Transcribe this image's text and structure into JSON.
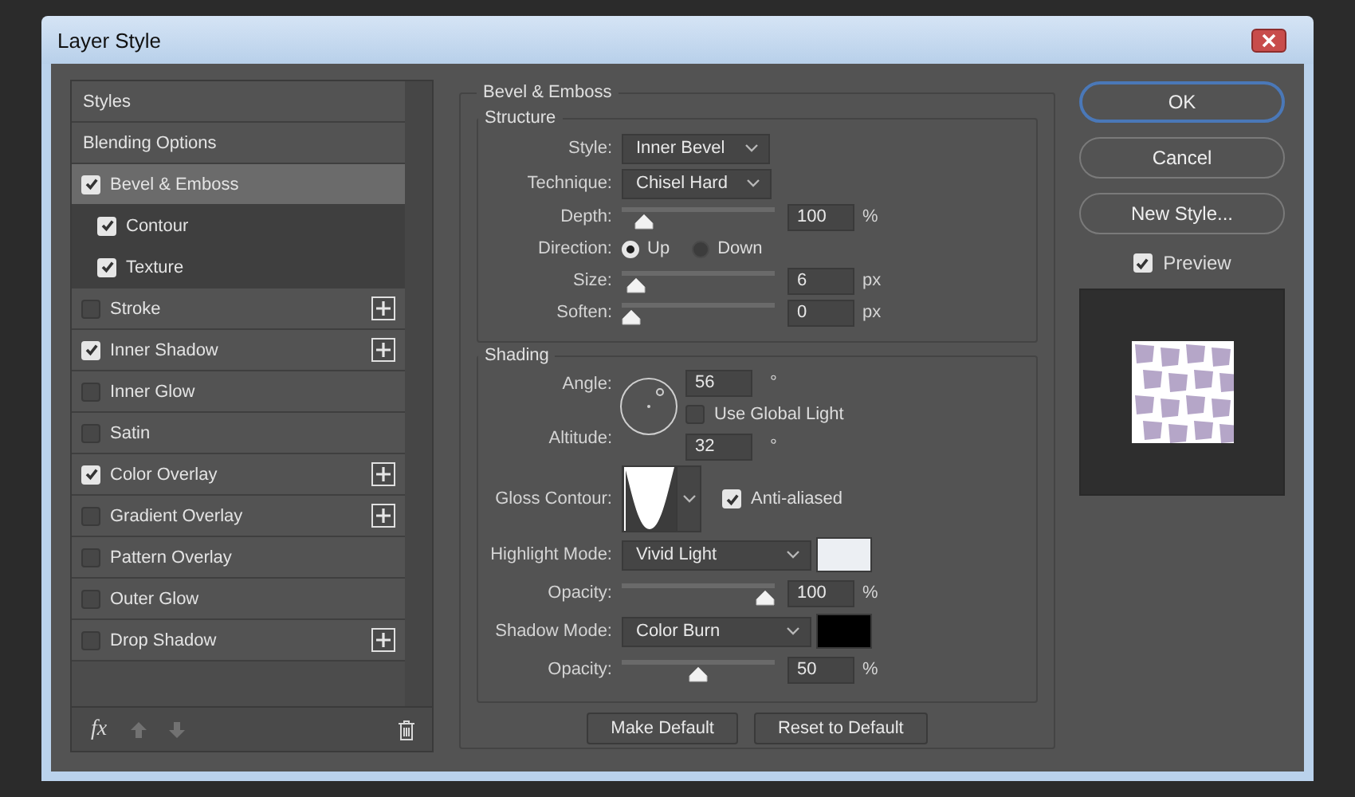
{
  "window": {
    "title": "Layer Style"
  },
  "sidebar": {
    "items": [
      {
        "label": "Styles",
        "kind": "header",
        "selected": false,
        "add": false
      },
      {
        "label": "Blending Options",
        "kind": "header",
        "selected": false,
        "add": false
      },
      {
        "label": "Bevel & Emboss",
        "kind": "effect",
        "checked": true,
        "selected": true,
        "add": false,
        "children": [
          {
            "label": "Contour",
            "kind": "effect",
            "checked": true,
            "selected": false,
            "add": false
          },
          {
            "label": "Texture",
            "kind": "effect",
            "checked": true,
            "selected": false,
            "add": false
          }
        ]
      },
      {
        "label": "Stroke",
        "kind": "effect",
        "checked": false,
        "selected": false,
        "add": true
      },
      {
        "label": "Inner Shadow",
        "kind": "effect",
        "checked": true,
        "selected": false,
        "add": true
      },
      {
        "label": "Inner Glow",
        "kind": "effect",
        "checked": false,
        "selected": false,
        "add": false
      },
      {
        "label": "Satin",
        "kind": "effect",
        "checked": false,
        "selected": false,
        "add": false
      },
      {
        "label": "Color Overlay",
        "kind": "effect",
        "checked": true,
        "selected": false,
        "add": true
      },
      {
        "label": "Gradient Overlay",
        "kind": "effect",
        "checked": false,
        "selected": false,
        "add": true
      },
      {
        "label": "Pattern Overlay",
        "kind": "effect",
        "checked": false,
        "selected": false,
        "add": false
      },
      {
        "label": "Outer Glow",
        "kind": "effect",
        "checked": false,
        "selected": false,
        "add": false
      },
      {
        "label": "Drop Shadow",
        "kind": "effect",
        "checked": false,
        "selected": false,
        "add": true
      }
    ],
    "toolbar": {
      "fx_label": "fx",
      "move_up": {
        "disabled": true
      },
      "move_down": {
        "disabled": true
      }
    }
  },
  "settings": {
    "title": "Bevel & Emboss",
    "structure": {
      "title": "Structure",
      "rows": [
        {
          "kind": "dropdown",
          "label": "Style:",
          "value": "Inner Bevel"
        },
        {
          "kind": "dropdown",
          "label": "Technique:",
          "value": "Chisel Hard"
        },
        {
          "kind": "slider",
          "label": "Depth:",
          "level": 0.1,
          "value": "100",
          "unit": "%"
        },
        {
          "kind": "radio",
          "label": "Direction:",
          "options": [
            {
              "label": "Up",
              "selected": true
            },
            {
              "label": "Down",
              "selected": false
            }
          ]
        },
        {
          "kind": "slider",
          "label": "Size:",
          "level": 0.04,
          "value": "6",
          "unit": "px"
        },
        {
          "kind": "slider",
          "label": "Soften:",
          "level": 0,
          "value": "0",
          "unit": "px"
        }
      ]
    },
    "shading": {
      "title": "Shading",
      "angle": {
        "label": "Angle:",
        "value": "56",
        "unit": "°"
      },
      "global_light": {
        "label": "Use Global Light",
        "checked": false
      },
      "altitude": {
        "label": "Altitude:",
        "value": "32",
        "unit": "°"
      },
      "gloss_contour": {
        "label": "Gloss Contour:"
      },
      "anti_aliased": {
        "label": "Anti-aliased",
        "checked": true
      },
      "rows": [
        {
          "kind": "mode",
          "label": "Highlight Mode:",
          "value": "Vivid Light",
          "color": "#eceff3"
        },
        {
          "kind": "slider",
          "label": "Opacity:",
          "level": 1,
          "value": "100",
          "unit": "%"
        },
        {
          "kind": "mode",
          "label": "Shadow Mode:",
          "value": "Color Burn",
          "color": "#000000"
        },
        {
          "kind": "slider",
          "label": "Opacity:",
          "level": 0.5,
          "value": "50",
          "unit": "%"
        }
      ]
    },
    "buttons": [
      "Make Default",
      "Reset to Default"
    ]
  },
  "actions": {
    "buttons": [
      {
        "label": "OK",
        "kind": "primary"
      },
      {
        "label": "Cancel",
        "kind": "normal"
      },
      {
        "label": "New Style...",
        "kind": "normal"
      }
    ],
    "preview": {
      "label": "Preview",
      "checked": true
    }
  }
}
